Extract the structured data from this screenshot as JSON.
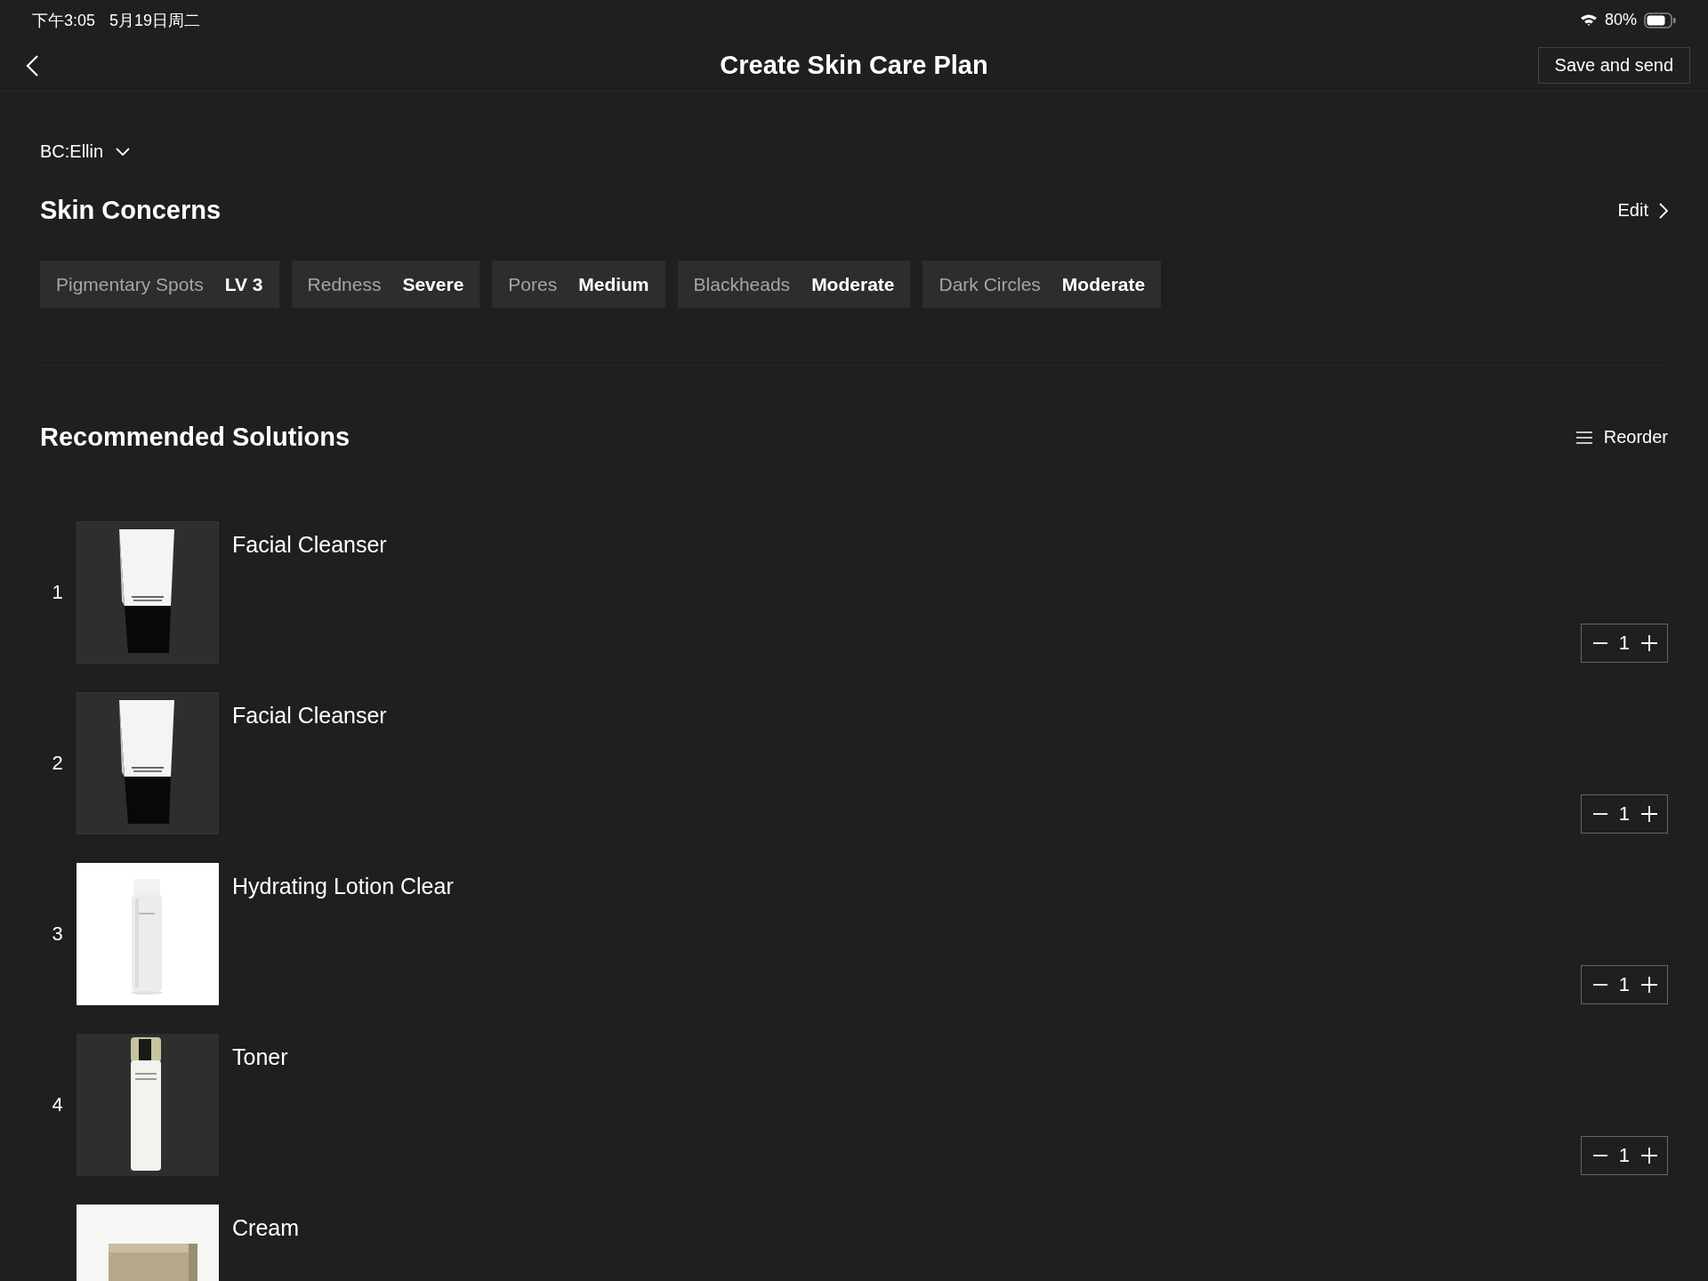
{
  "status_bar": {
    "time": "下午3:05",
    "date": "5月19日周二",
    "battery": "80%"
  },
  "header": {
    "title": "Create Skin Care Plan",
    "action": "Save and send"
  },
  "consultant": {
    "label": "BC:Ellin"
  },
  "skin_concerns": {
    "title": "Skin Concerns",
    "edit": "Edit",
    "items": [
      {
        "name": "Pigmentary Spots",
        "value": "LV 3"
      },
      {
        "name": "Redness",
        "value": "Severe"
      },
      {
        "name": "Pores",
        "value": "Medium"
      },
      {
        "name": "Blackheads",
        "value": "Moderate"
      },
      {
        "name": "Dark Circles",
        "value": "Moderate"
      }
    ]
  },
  "solutions": {
    "title": "Recommended Solutions",
    "reorder": "Reorder",
    "items": [
      {
        "index": "1",
        "name": "Facial Cleanser",
        "quantity": "1"
      },
      {
        "index": "2",
        "name": "Facial Cleanser",
        "quantity": "1"
      },
      {
        "index": "3",
        "name": "Hydrating Lotion Clear",
        "quantity": "1"
      },
      {
        "index": "4",
        "name": "Toner",
        "quantity": "1"
      },
      {
        "name": "Cream"
      }
    ]
  }
}
